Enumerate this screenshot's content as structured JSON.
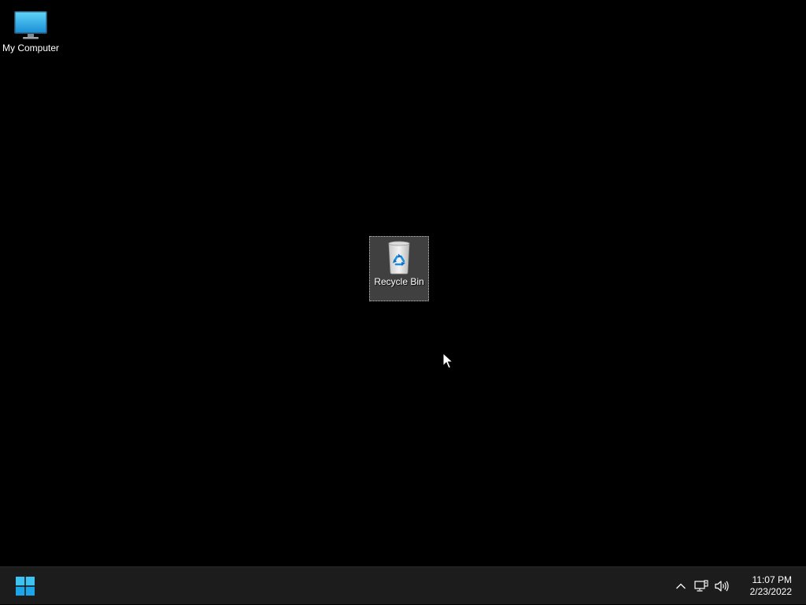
{
  "desktop": {
    "background_color": "#000000",
    "icons": [
      {
        "label": "My Computer",
        "icon": "monitor-icon"
      },
      {
        "label": "Recycle Bin",
        "icon": "recycle-bin-icon",
        "selected": true
      }
    ]
  },
  "taskbar": {
    "start_icon": "windows-logo-icon",
    "tray_icons": [
      "chevron-up-icon",
      "network-icon",
      "speaker-icon"
    ],
    "time": "11:07 PM",
    "date": "2/23/2022"
  },
  "colors": {
    "accent": "#0078d4",
    "taskbar": "#1c1c1c"
  }
}
